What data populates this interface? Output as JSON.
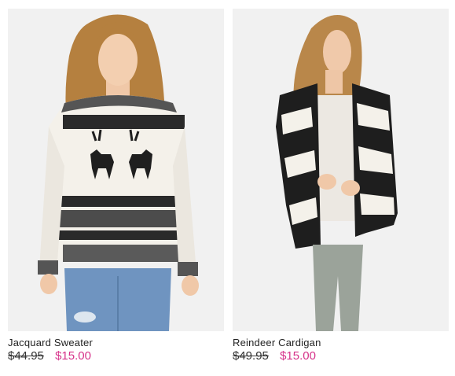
{
  "colors": {
    "sale": "#d6338a",
    "text": "#222222",
    "photo_background": "#f1f1f1"
  },
  "products": [
    {
      "name": "Jacquard Sweater",
      "original_price": "$44.95",
      "sale_price": "$15.00",
      "image_icon": "jacquard-sweater-photo"
    },
    {
      "name": "Reindeer Cardigan",
      "original_price": "$49.95",
      "sale_price": "$15.00",
      "image_icon": "reindeer-cardigan-photo"
    }
  ]
}
